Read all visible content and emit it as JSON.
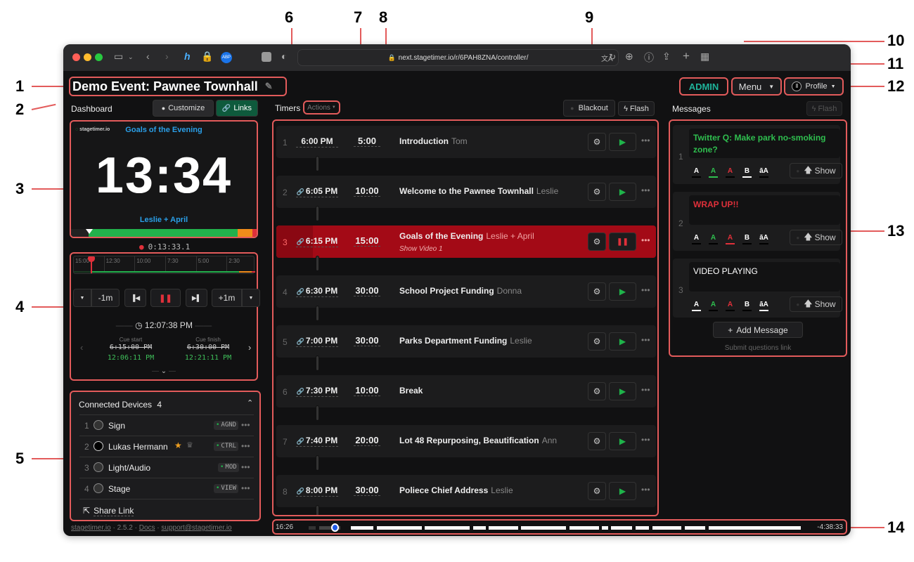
{
  "annotations": [
    "1",
    "2",
    "3",
    "4",
    "5",
    "6",
    "7",
    "8",
    "9",
    "10",
    "11",
    "12",
    "13",
    "14"
  ],
  "browser": {
    "url": "next.stagetimer.io/r/6PAH8ZNA/controller/"
  },
  "header": {
    "event_title": "Demo Event: Pawnee Townhall",
    "admin_label": "ADMIN",
    "menu_label": "Menu",
    "profile_label": "Profile"
  },
  "dashboard": {
    "label": "Dashboard",
    "customize_label": "Customize",
    "links_label": "Links"
  },
  "preview": {
    "logo": "stagetimer.io",
    "title": "Goals of the Evening",
    "time": "13:34",
    "speaker": "Leslie + April",
    "elapsed": "0:13:33.1"
  },
  "controls": {
    "ticks": [
      "15:00",
      "12:30",
      "10:00",
      "7:30",
      "5:00",
      "2:30"
    ],
    "minus_label": "-1m",
    "plus_label": "+1m",
    "clock": "12:07:38 PM",
    "cue_start_label": "Cue start",
    "cue_finish_label": "Cue finish",
    "cue_start_planned": "6:15:00 PM",
    "cue_finish_planned": "6:30:00 PM",
    "cue_start_actual": "12:06:11 PM",
    "cue_finish_actual": "12:21:11 PM"
  },
  "devices": {
    "title": "Connected Devices",
    "count": "4",
    "items": [
      {
        "num": "1",
        "name": "Sign",
        "tag": "AGND"
      },
      {
        "num": "2",
        "name": "Lukas Hermann",
        "tag": "CTRL"
      },
      {
        "num": "3",
        "name": "Light/Audio",
        "tag": "MOD"
      },
      {
        "num": "4",
        "name": "Stage",
        "tag": "VIEW"
      }
    ],
    "share_label": "Share Link"
  },
  "footer": {
    "site": "stagetimer.io",
    "version": "2.5.2",
    "docs": "Docs",
    "support": "support@stagetimer.io"
  },
  "timers": {
    "label": "Timers",
    "actions_label": "Actions",
    "blackout_label": "Blackout",
    "flash_label": "Flash",
    "items": [
      {
        "num": "1",
        "start": "6:00 PM",
        "duration": "5:00",
        "title": "Introduction",
        "speaker": "Tom",
        "note": "",
        "active": false
      },
      {
        "num": "2",
        "start": "6:05 PM",
        "duration": "10:00",
        "title": "Welcome to the Pawnee Townhall",
        "speaker": "Leslie",
        "note": "",
        "active": false
      },
      {
        "num": "3",
        "start": "6:15 PM",
        "duration": "15:00",
        "title": "Goals of the Evening",
        "speaker": "Leslie + April",
        "note": "Show Video 1",
        "active": true
      },
      {
        "num": "4",
        "start": "6:30 PM",
        "duration": "30:00",
        "title": "School Project Funding",
        "speaker": "Donna",
        "note": "",
        "active": false
      },
      {
        "num": "5",
        "start": "7:00 PM",
        "duration": "30:00",
        "title": "Parks Department Funding",
        "speaker": "Leslie",
        "note": "",
        "active": false
      },
      {
        "num": "6",
        "start": "7:30 PM",
        "duration": "10:00",
        "title": "Break",
        "speaker": "",
        "note": "",
        "active": false
      },
      {
        "num": "7",
        "start": "7:40 PM",
        "duration": "20:00",
        "title": "Lot 48 Repurposing, Beautification",
        "speaker": "Ann",
        "note": "",
        "active": false
      },
      {
        "num": "8",
        "start": "8:00 PM",
        "duration": "30:00",
        "title": "Poliece Chief Address",
        "speaker": "Leslie",
        "note": "",
        "active": false
      }
    ]
  },
  "messages": {
    "label": "Messages",
    "flash_label": "Flash",
    "items": [
      {
        "num": "1",
        "text": "Twitter Q: Make park no-smoking zone?",
        "color": "#2fbf4f"
      },
      {
        "num": "2",
        "text": "WRAP UP!!",
        "color": "#e0303a"
      },
      {
        "num": "3",
        "text": "VIDEO PLAYING",
        "color": "#ffffff"
      }
    ],
    "format_labels": [
      "A",
      "A",
      "A",
      "B",
      "āA"
    ],
    "show_label": "Show",
    "add_label": "Add Message",
    "submit_link": "Submit questions link"
  },
  "timeline": {
    "elapsed": "16:26",
    "remaining": "-4:38:33"
  },
  "colors": {
    "accent_red": "#a30a16",
    "green": "#22b14c",
    "orange": "#f08c1a",
    "admin": "#1fb39a",
    "links_bg": "#0e5a3c",
    "preview_blue": "#2a9fe8"
  }
}
